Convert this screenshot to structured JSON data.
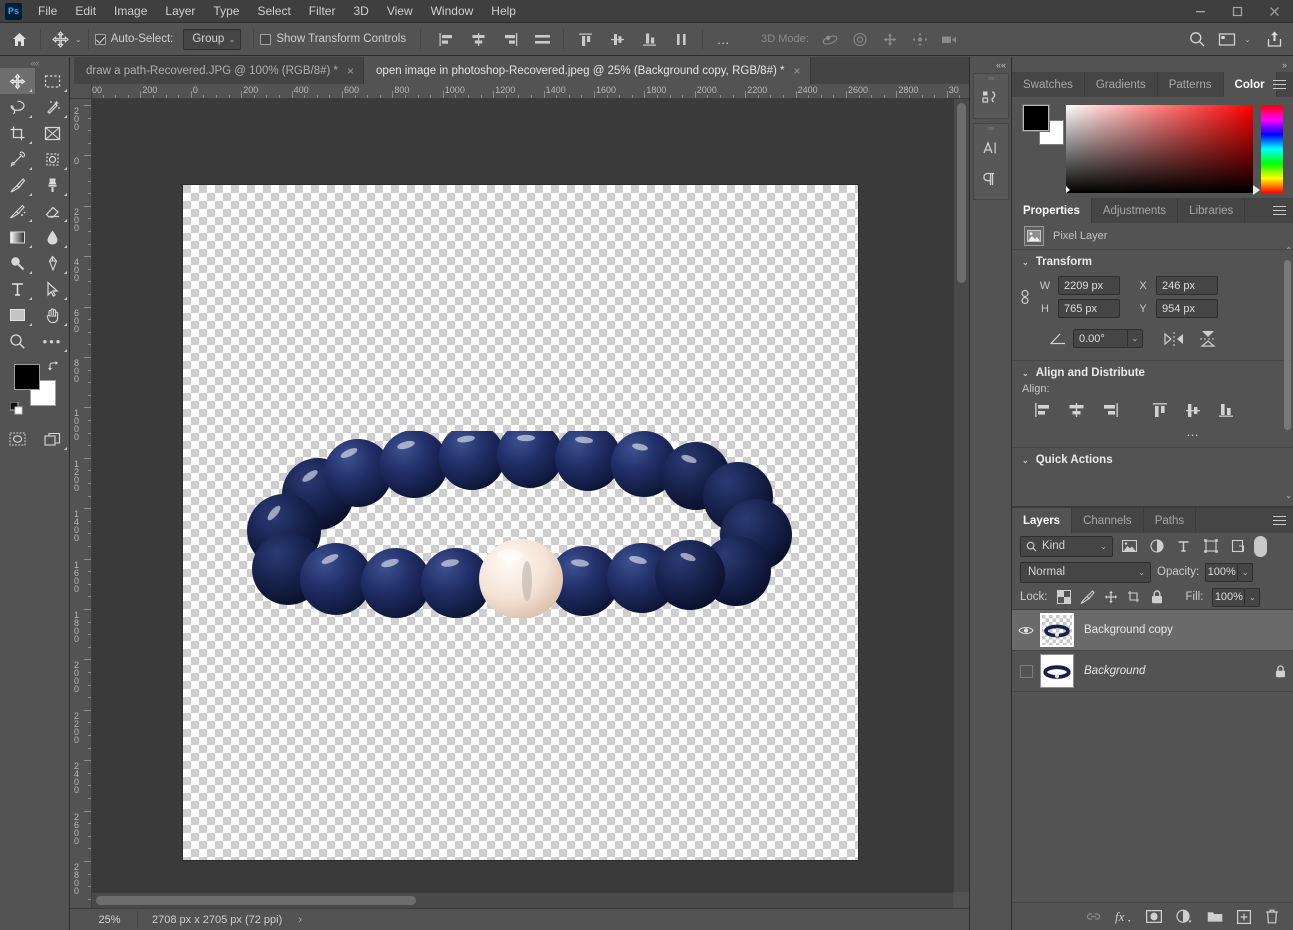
{
  "app": {
    "logo_text": "Ps",
    "name": "Adobe Photoshop"
  },
  "menubar": {
    "items": [
      "File",
      "Edit",
      "Image",
      "Layer",
      "Type",
      "Select",
      "Filter",
      "3D",
      "View",
      "Window",
      "Help"
    ]
  },
  "window_controls": {
    "minimize": "minimize-icon",
    "maximize": "maximize-icon",
    "close": "close-icon"
  },
  "options_bar": {
    "home_icon": "home-icon",
    "active_tool_icon": "move-tool-icon",
    "auto_select_checked": true,
    "auto_select_label": "Auto-Select:",
    "auto_select_scope": "Group",
    "show_transform_label": "Show Transform Controls",
    "show_transform_checked": false,
    "align_left_edges": "align-left-edges-icon",
    "align_horizontal_centers": "align-horizontal-centers-icon",
    "align_right_edges": "align-right-edges-icon",
    "distribute_horizontal": "distribute-horizontally-icon",
    "align_top_edges": "align-top-edges-icon",
    "align_vertical_centers": "align-vertical-centers-icon",
    "align_bottom_edges": "align-bottom-edges-icon",
    "distribute_vertical": "distribute-vertically-icon",
    "more_options": "…",
    "three_d_label": "3D Mode:",
    "three_d_tools": [
      "orbit-3d-icon",
      "roll-3d-icon",
      "pan-3d-icon",
      "slide-3d-icon",
      "zoom-3d-camera-icon"
    ],
    "search_icon": "search-icon",
    "workspace_icon": "workspace-switcher-icon",
    "share_icon": "share-icon"
  },
  "document_tabs": [
    {
      "title": "draw a path-Recovered.JPG @ 100% (RGB/8#) *",
      "active": false,
      "close": "×"
    },
    {
      "title": "open image in photoshop-Recovered.jpeg @ 25% (Background copy, RGB/8#) *",
      "active": true,
      "close": "×"
    }
  ],
  "toolbar": {
    "tools": [
      {
        "name": "move-tool",
        "icon": "move-icon",
        "selected": true
      },
      {
        "name": "rectangular-marquee-tool",
        "icon": "marquee-icon",
        "selected": false
      },
      {
        "name": "lasso-tool",
        "icon": "lasso-icon",
        "selected": false
      },
      {
        "name": "object-selection-tool",
        "icon": "magic-wand-icon",
        "selected": false
      },
      {
        "name": "crop-tool",
        "icon": "crop-icon",
        "selected": false
      },
      {
        "name": "frame-tool",
        "icon": "frame-icon",
        "selected": false
      },
      {
        "name": "eyedropper-tool",
        "icon": "eyedropper-icon",
        "selected": false
      },
      {
        "name": "spot-healing-brush-tool",
        "icon": "healing-brush-icon",
        "selected": false
      },
      {
        "name": "brush-tool",
        "icon": "brush-icon",
        "selected": false
      },
      {
        "name": "clone-stamp-tool",
        "icon": "clone-stamp-icon",
        "selected": false
      },
      {
        "name": "history-brush-tool",
        "icon": "history-brush-icon",
        "selected": false
      },
      {
        "name": "eraser-tool",
        "icon": "eraser-icon",
        "selected": false
      },
      {
        "name": "gradient-tool",
        "icon": "gradient-icon",
        "selected": false
      },
      {
        "name": "blur-tool",
        "icon": "blur-drop-icon",
        "selected": false
      },
      {
        "name": "dodge-tool",
        "icon": "dodge-icon",
        "selected": false
      },
      {
        "name": "pen-tool",
        "icon": "pen-icon",
        "selected": false
      },
      {
        "name": "horizontal-type-tool",
        "icon": "type-icon",
        "selected": false
      },
      {
        "name": "path-selection-tool",
        "icon": "path-arrow-icon",
        "selected": false
      },
      {
        "name": "rectangle-tool",
        "icon": "rectangle-icon",
        "selected": false
      },
      {
        "name": "hand-tool",
        "icon": "hand-icon",
        "selected": false
      },
      {
        "name": "zoom-tool",
        "icon": "zoom-icon",
        "selected": false
      },
      {
        "name": "edit-toolbar",
        "icon": "more-tools-icon",
        "selected": false
      }
    ],
    "foreground_color": "#000000",
    "background_color": "#ffffff",
    "swap_colors_icon": "swap-colors-icon",
    "default_colors_icon": "default-colors-icon",
    "quick_mask_icon": "quick-mask-icon",
    "screen_mode_icon": "screen-mode-icon"
  },
  "rulers": {
    "horizontal_labels": [
      "00",
      "200",
      "0",
      "200",
      "400",
      "600",
      "800",
      "1000",
      "1200",
      "1400",
      "1600",
      "1800",
      "2000",
      "2200",
      "2400",
      "2600",
      "2800",
      "30"
    ],
    "vertical_labels": [
      "200",
      "0",
      "200",
      "400",
      "600",
      "800",
      "1000",
      "1200",
      "1400",
      "1600",
      "1800",
      "2000",
      "2200",
      "2400",
      "2600",
      "2800"
    ]
  },
  "canvas": {
    "artwork": "beaded-bracelet-lapis-lazuli-with-pearl",
    "bead_color": "#1d2a56",
    "pearl_color": "#f2e5dc",
    "transparent_background": true
  },
  "status_bar": {
    "zoom": "25%",
    "doc_size": "2708 px x 2705 px (72 ppi)",
    "expand_arrow": "›"
  },
  "mini_dock": {
    "collapse_icon": "collapse-panels-icon",
    "groups": [
      {
        "name": "history-panel-icon"
      },
      {
        "name": "character-panel-icon"
      },
      {
        "name": "paragraph-panel-icon"
      }
    ]
  },
  "color_panel": {
    "collapse_icon": "»",
    "tabs": [
      {
        "label": "Swatches",
        "active": false
      },
      {
        "label": "Gradients",
        "active": false
      },
      {
        "label": "Patterns",
        "active": false
      },
      {
        "label": "Color",
        "active": true
      }
    ],
    "menu_icon": "panel-menu-icon",
    "foreground": "#000000",
    "background": "#ffffff",
    "picker_hue": "#ff0000"
  },
  "properties_panel": {
    "tabs": [
      {
        "label": "Properties",
        "active": true
      },
      {
        "label": "Adjustments",
        "active": false
      },
      {
        "label": "Libraries",
        "active": false
      }
    ],
    "menu_icon": "panel-menu-icon",
    "layer_type_icon": "pixel-layer-icon",
    "layer_type": "Pixel Layer",
    "transform": {
      "title": "Transform",
      "link_icon": "link-dimensions-icon",
      "w_label": "W",
      "w_value": "2209 px",
      "x_label": "X",
      "x_value": "246 px",
      "h_label": "H",
      "h_value": "765 px",
      "y_label": "Y",
      "y_value": "954 px",
      "angle_icon": "angle-icon",
      "angle_value": "0.00°",
      "flip_horizontal_icon": "flip-horizontal-icon",
      "flip_vertical_icon": "flip-vertical-icon"
    },
    "align": {
      "title": "Align and Distribute",
      "align_label": "Align:",
      "icons": [
        "align-left-edges-icon",
        "align-horizontal-centers-icon",
        "align-right-edges-icon",
        "align-top-edges-icon",
        "align-vertical-centers-icon",
        "align-bottom-edges-icon"
      ],
      "more": "…"
    },
    "quick_actions": {
      "title": "Quick Actions"
    }
  },
  "layers_panel": {
    "tabs": [
      {
        "label": "Layers",
        "active": true
      },
      {
        "label": "Channels",
        "active": false
      },
      {
        "label": "Paths",
        "active": false
      }
    ],
    "menu_icon": "panel-menu-icon",
    "filter": {
      "search_icon": "search-icon",
      "kind_label": "Kind",
      "chevron": "⌄",
      "filter_icons": [
        "filter-pixel-icon",
        "filter-adjustment-icon",
        "filter-type-icon",
        "filter-shape-icon",
        "filter-smart-object-icon"
      ],
      "toggle": "filter-toggle-switch"
    },
    "blend_mode": "Normal",
    "opacity_label": "Opacity:",
    "opacity_value": "100%",
    "lock_label": "Lock:",
    "lock_icons": [
      "lock-transparent-pixels-icon",
      "lock-image-pixels-icon",
      "lock-position-icon",
      "lock-artboard-nesting-icon",
      "lock-all-icon"
    ],
    "fill_label": "Fill:",
    "fill_value": "100%",
    "layers": [
      {
        "name": "Background copy",
        "visible": true,
        "selected": true,
        "locked": false,
        "thumb": "checker",
        "italic": false
      },
      {
        "name": "Background",
        "visible": false,
        "selected": false,
        "locked": true,
        "thumb": "white",
        "italic": true
      }
    ],
    "footer_icons": [
      "link-layers-icon",
      "layer-style-fx-icon",
      "add-layer-mask-icon",
      "new-fill-adjustment-layer-icon",
      "new-group-icon",
      "new-layer-icon",
      "delete-layer-icon"
    ]
  }
}
